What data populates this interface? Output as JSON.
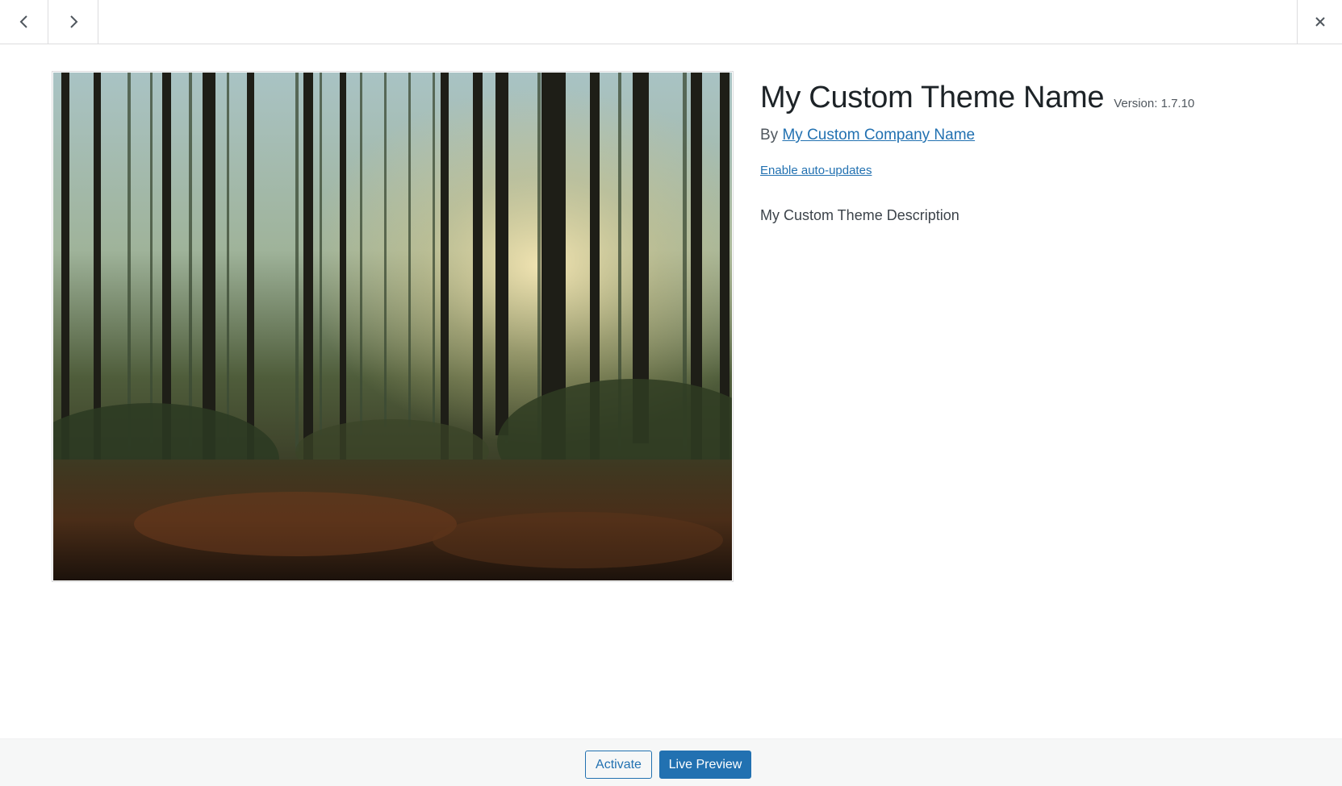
{
  "header": {
    "prev_icon": "chevron-left-icon",
    "next_icon": "chevron-right-icon",
    "close_icon": "close-icon"
  },
  "theme": {
    "name": "My Custom Theme Name",
    "version": "Version: 1.7.10",
    "author_prefix": "By",
    "author_name": "My Custom Company Name",
    "auto_updates_link": "Enable auto-updates",
    "description": "My Custom Theme Description",
    "screenshot_alt": "Forest of tall pine trees with misty sunlight"
  },
  "footer": {
    "activate_label": "Activate",
    "live_preview_label": "Live Preview"
  },
  "colors": {
    "accent": "#2271b1",
    "footer_bg": "#f6f7f7",
    "border": "#dcdcde"
  }
}
